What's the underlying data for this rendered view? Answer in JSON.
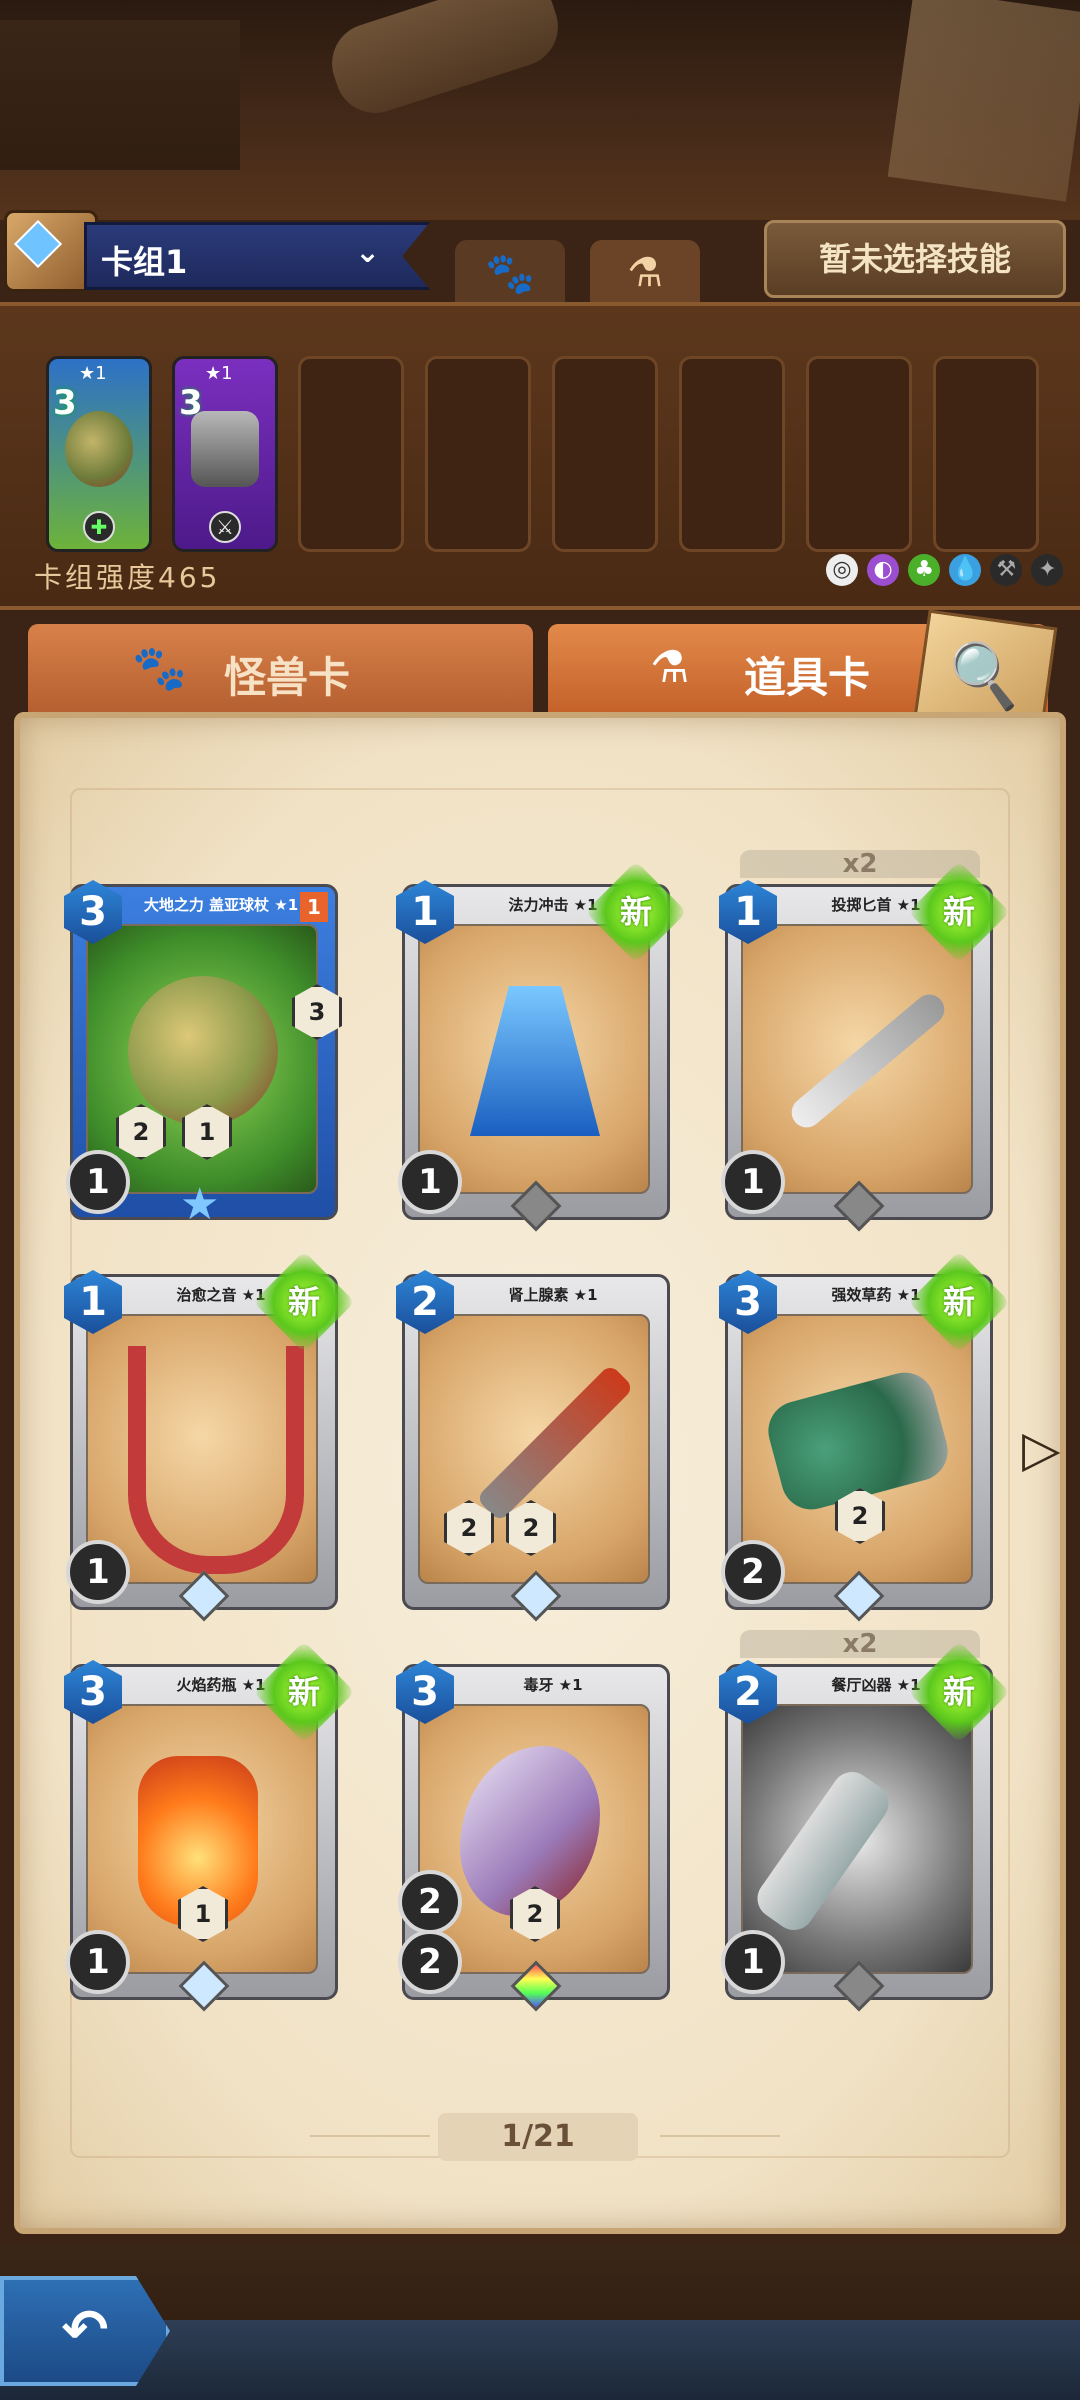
{
  "header": {
    "deck_name": "卡组1",
    "skill_button": "暂未选择技能"
  },
  "deck": {
    "strength_label": "卡组强度465",
    "cards": [
      {
        "cost": "3",
        "stars": "★1"
      },
      {
        "cost": "3",
        "stars": "★1"
      }
    ]
  },
  "tabs": {
    "monster": "怪兽卡",
    "item": "道具卡"
  },
  "cards": [
    {
      "title": "大地之力 盖亚球杖 ★1",
      "cost": "3",
      "bottom": "1",
      "hex1": "2",
      "hex2": "1",
      "hex3": "3",
      "corner": "1"
    },
    {
      "title": "法力冲击 ★1",
      "cost": "1",
      "bottom": "1",
      "badge": "新"
    },
    {
      "title": "投掷匕首 ★1",
      "cost": "1",
      "bottom": "1",
      "badge": "新",
      "dup": "x2"
    },
    {
      "title": "治愈之音 ★1",
      "cost": "1",
      "bottom": "1",
      "badge": "新"
    },
    {
      "title": "肾上腺素 ★1",
      "cost": "2",
      "hex1": "2",
      "hex2": "2"
    },
    {
      "title": "强效草药 ★1",
      "cost": "3",
      "bottom": "2",
      "hex1": "2",
      "badge": "新"
    },
    {
      "title": "火焰药瓶 ★1",
      "cost": "3",
      "bottom": "1",
      "hex1": "1",
      "badge": "新"
    },
    {
      "title": "毒牙 ★1",
      "cost": "3",
      "bottom": "2",
      "bottom2": "2",
      "hex1": "2"
    },
    {
      "title": "餐厅凶器 ★1",
      "cost": "2",
      "bottom": "1",
      "badge": "新",
      "dup": "x2"
    }
  ],
  "pager": "1/21"
}
